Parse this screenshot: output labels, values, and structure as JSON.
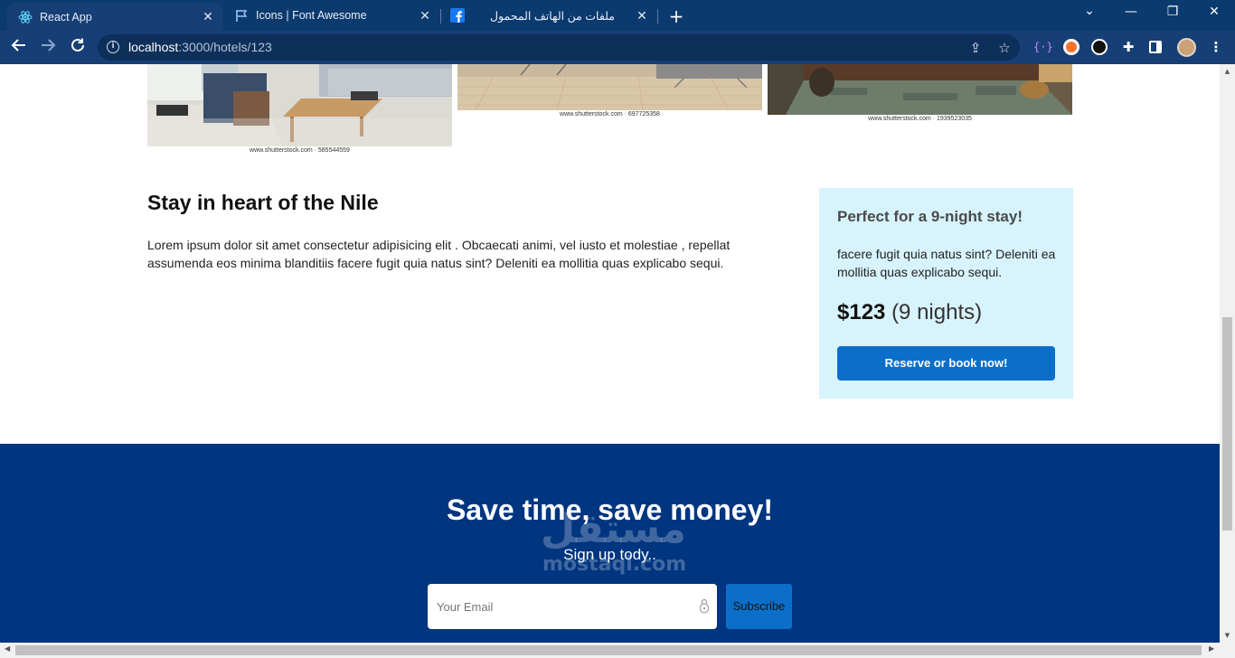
{
  "browser": {
    "tabs": [
      {
        "title": "React App",
        "favicon": "react-icon"
      },
      {
        "title": "Icons | Font Awesome",
        "favicon": "flag-icon"
      },
      {
        "title": "ملفات من الهاتف المحمول",
        "favicon": "facebook-icon"
      }
    ],
    "url_host": "localhost",
    "url_path": ":3000/hotels/123"
  },
  "gallery": {
    "captions": [
      "www.shutterstock.com · 585544559",
      "www.shutterstock.com · 697725358",
      "www.shutterstock.com · 1939523035"
    ]
  },
  "hotel": {
    "heading": "Stay in heart of the Nile",
    "description": "Lorem ipsum dolor sit amet consectetur adipisicing elit . Obcaecati animi, vel iusto et molestiae , repellat assumenda eos minima blanditiis facere fugit quia natus sint? Deleniti ea mollitia quas explicabo sequi."
  },
  "booking_card": {
    "heading": "Perfect for a 9-night stay!",
    "text": "facere fugit quia natus sint? Deleniti ea mollitia quas explicabo sequi.",
    "price": "$123",
    "nights": "(9 nights)",
    "button_label": "Reserve or book now!"
  },
  "footer": {
    "heading": "Save time, save money!",
    "subheading": "Sign up tody..",
    "email_placeholder": "Your Email",
    "subscribe_label": "Subscribe"
  },
  "watermark": {
    "text": "مستقل",
    "domain": "mostaql.com"
  }
}
